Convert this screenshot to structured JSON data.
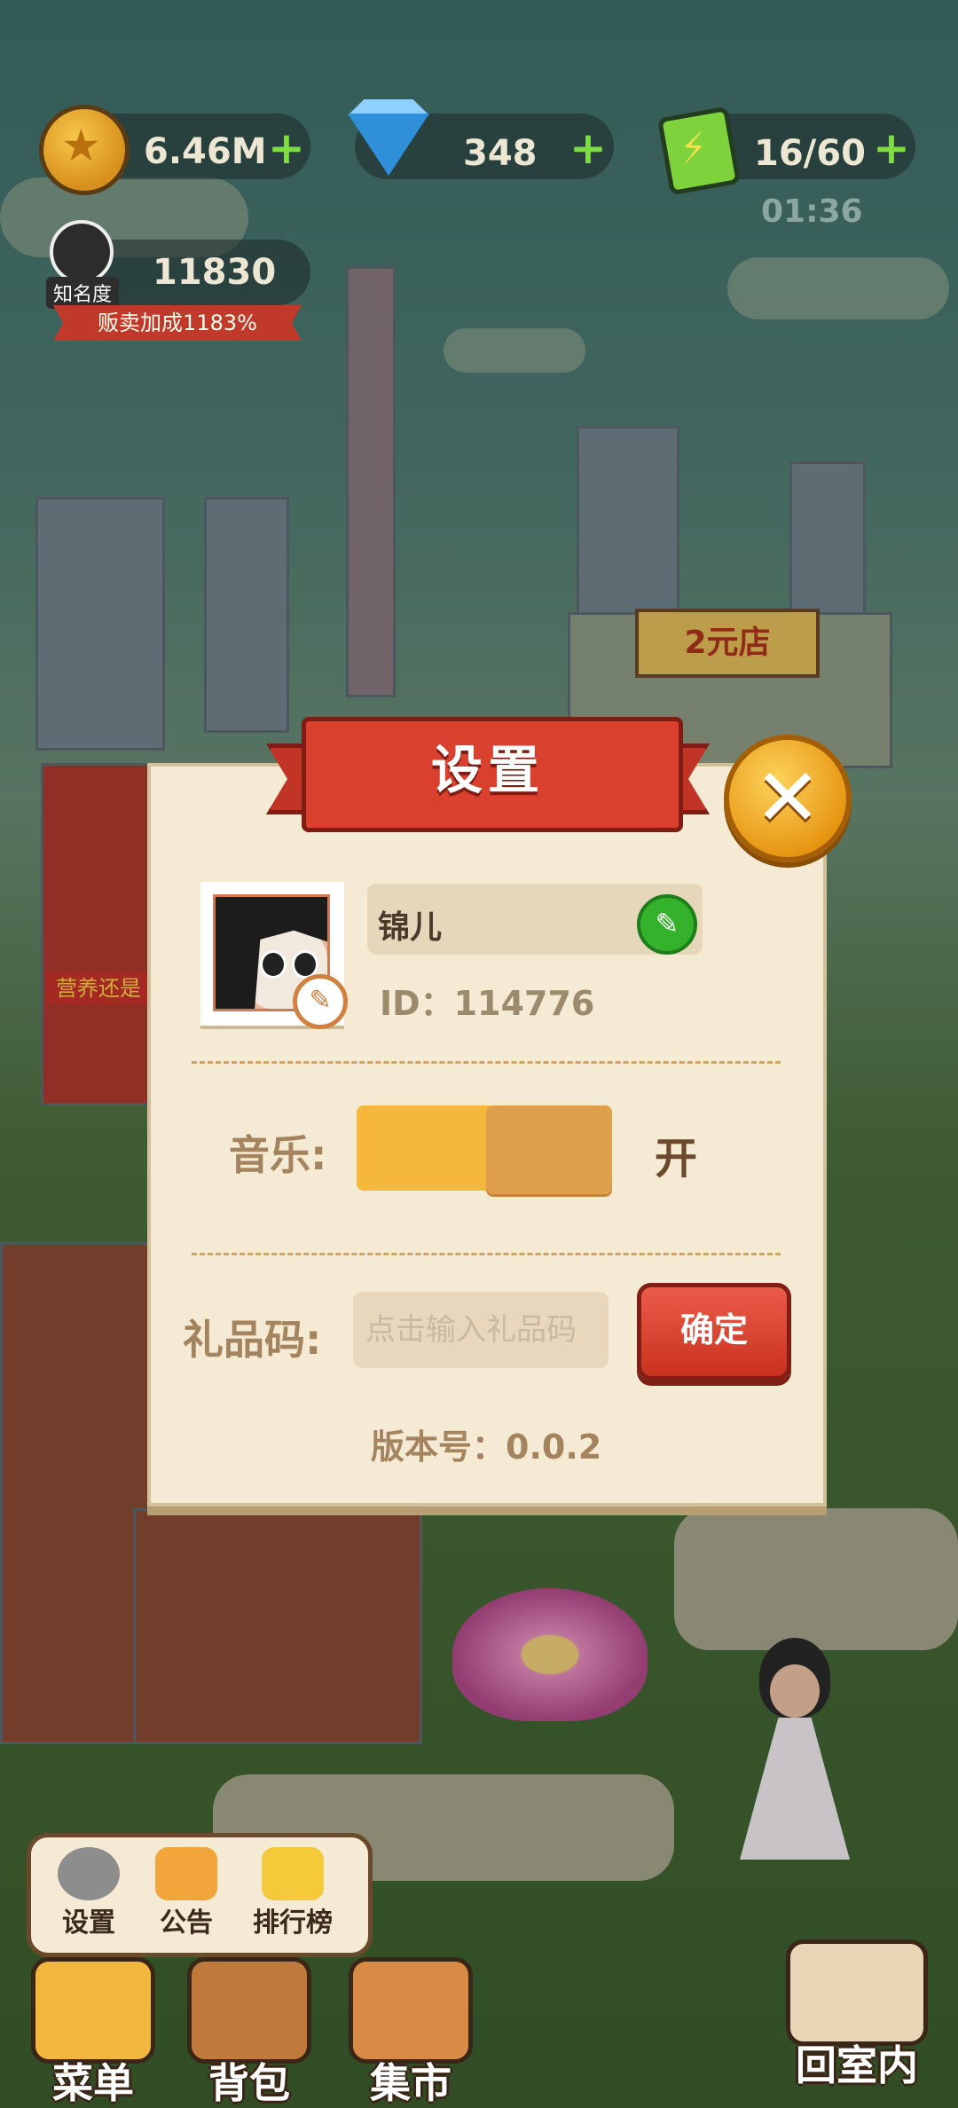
{
  "hud": {
    "coins": "6.46M",
    "gems": "348",
    "energy": "16/60",
    "energy_timer": "01:36",
    "plus": "+",
    "fame_value": "11830",
    "fame_label": "知名度",
    "sell_bonus": "贩卖加成1183%"
  },
  "background": {
    "shop_sign": "2元店",
    "store_banner": "营养还是"
  },
  "settings_dialog": {
    "title": "设置",
    "close_symbol": "✕",
    "player_name": "锦儿",
    "player_id": "ID：114776",
    "music_label": "音乐:",
    "music_state": "开",
    "music_on": true,
    "gift_label": "礼品码:",
    "gift_placeholder": "点击输入礼品码",
    "gift_value": "",
    "confirm_label": "确定",
    "version": "版本号：0.0.2"
  },
  "menu_popup": {
    "items": [
      {
        "label": "设置",
        "icon": "gear-icon"
      },
      {
        "label": "公告",
        "icon": "megaphone-icon"
      },
      {
        "label": "排行榜",
        "icon": "crown-icon"
      }
    ]
  },
  "bottom_bar": {
    "menu": "菜单",
    "backpack": "背包",
    "market": "集市",
    "return_indoor": "回室内"
  },
  "colors": {
    "panel_bg": "#f5ead3",
    "ribbon_red": "#d9402e",
    "confirm_red": "#c9321f",
    "toggle_on": "#f6b73d",
    "close_gold": "#e6930f"
  }
}
